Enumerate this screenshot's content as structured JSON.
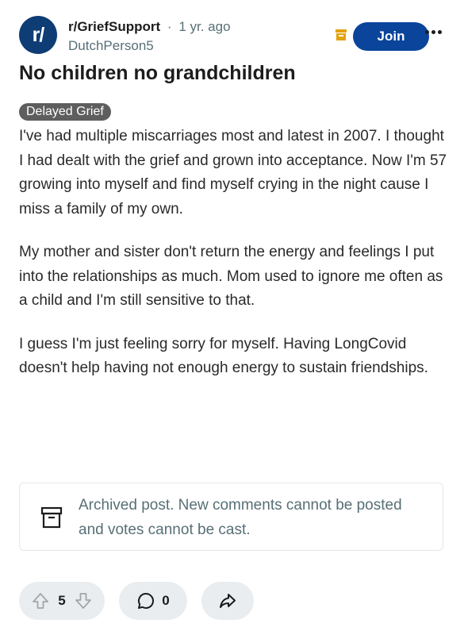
{
  "post": {
    "subreddit": "r/GriefSupport",
    "avatar_text": "r/",
    "time_separator": "·",
    "time_ago": "1 yr. ago",
    "author": "DutchPerson5",
    "title": "No children no grandchildren",
    "flair": "Delayed Grief",
    "paragraphs": [
      "I've had multiple miscarriages most and latest in 2007. I thought I had dealt with the grief and grown into acceptance. Now I'm 57 growing into myself and find myself crying in the night cause I miss a family of my own.",
      "My mother and sister don't return the energy and feelings I put into the relationships as much. Mom used to ignore me often as a child and I'm still sensitive to that.",
      "I guess I'm just feeling sorry for myself. Having LongCovid doesn't help having not enough energy to sustain friendships."
    ]
  },
  "header": {
    "join_label": "Join",
    "icons": {
      "archive": "archive-icon",
      "more": "more-options-icon"
    }
  },
  "archived_notice": {
    "text": "Archived post. New comments cannot be posted and votes cannot be cast.",
    "icon": "archive-box-icon"
  },
  "actions": {
    "vote_count": "5",
    "comment_count": "0",
    "icons": {
      "upvote": "upvote-arrow-icon",
      "downvote": "downvote-arrow-icon",
      "comment": "comment-bubble-icon",
      "share": "share-arrow-icon"
    }
  },
  "colors": {
    "avatar_bg": "#0e3c74",
    "join_button_bg": "#0a449b",
    "flair_bg": "#5e5e5e",
    "archive_mini_icon": "#e3a20b",
    "secondary_text": "#576f76",
    "pill_bg": "#eaedef"
  }
}
